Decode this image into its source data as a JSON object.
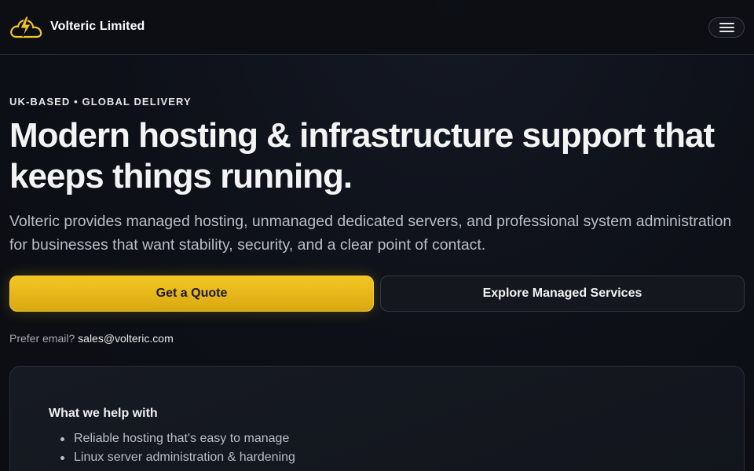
{
  "header": {
    "brand_name": "Volteric Limited",
    "logo_icon": "cloud-lightning-icon",
    "menu_icon": "hamburger-menu-icon"
  },
  "hero": {
    "eyebrow": "UK-BASED • GLOBAL DELIVERY",
    "headline": "Modern hosting & infrastructure support that keeps things running.",
    "subtext": "Volteric provides managed hosting, unmanaged dedicated servers, and professional system administration for businesses that want stability, security, and a clear point of contact.",
    "primary_button": "Get a Quote",
    "secondary_button": "Explore Managed Services",
    "email_prefix": "Prefer email?",
    "email": "sales@volteric.com"
  },
  "help_card": {
    "title": "What we help with",
    "items": [
      "Reliable hosting that's easy to manage",
      "Linux server administration & hardening"
    ]
  },
  "colors": {
    "accent": "#f3c623",
    "background": "#0b0d12",
    "text": "#f2f2f2",
    "muted": "#b9bdc6"
  }
}
